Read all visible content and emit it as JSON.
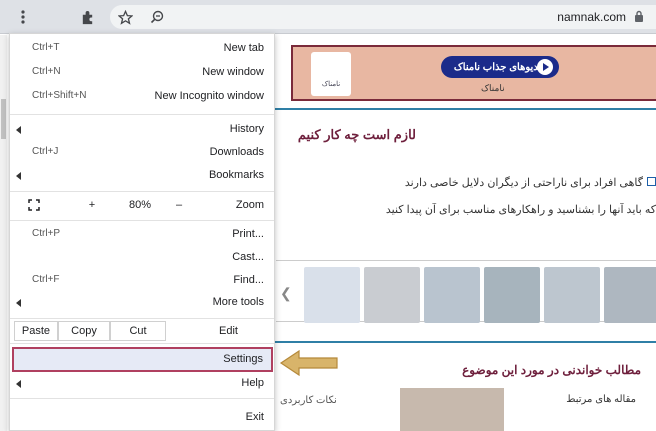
{
  "browser": {
    "url": "namnak.com",
    "icons": [
      "menu-dots-icon",
      "puzzle-extensions-icon",
      "bookmark-star-icon",
      "zoom-icon",
      "lock-icon"
    ]
  },
  "menu": {
    "new_tab": {
      "label": "New tab",
      "shortcut": "Ctrl+T"
    },
    "new_window": {
      "label": "New window",
      "shortcut": "Ctrl+N"
    },
    "new_incognito": {
      "label": "New Incognito window",
      "shortcut": "Ctrl+Shift+N"
    },
    "history": {
      "label": "History"
    },
    "downloads": {
      "label": "Downloads",
      "shortcut": "Ctrl+J"
    },
    "bookmarks": {
      "label": "Bookmarks"
    },
    "zoom": {
      "label": "Zoom",
      "minus": "–",
      "value": "80%",
      "plus": "+"
    },
    "print": {
      "label": "Print...",
      "shortcut": "Ctrl+P"
    },
    "cast": {
      "label": "Cast..."
    },
    "find": {
      "label": "Find...",
      "shortcut": "Ctrl+F"
    },
    "more_tools": {
      "label": "More tools"
    },
    "edit": {
      "label": "Edit",
      "cut": "Cut",
      "copy": "Copy",
      "paste": "Paste"
    },
    "settings": {
      "label": "Settings"
    },
    "help": {
      "label": "Help"
    },
    "exit": {
      "label": "Exit"
    }
  },
  "page": {
    "ad": {
      "logo_text": "نامناک",
      "pill_text": "ویدیوهای جذاب نامناک",
      "sub_text": "نامناک"
    },
    "heading": "ل‍ازم است چه کار کن‍ی‍م",
    "para_line1": "گاهی افراد برای ناراحتی از دیگران دلایل خاصی دارند",
    "para_line2": "که باید آنها را بشناسید و راهکارهای مناسب برای آن پیدا کنید",
    "bottom_title": "مطالب خواندنی در مورد این موضوع",
    "bottom_sub": "مقاله های مرتبط",
    "bottom_left": "نکات کاربردی"
  },
  "colors": {
    "toolbar": "#dee1e6",
    "accent_maroon": "#6e1f3c",
    "settings_highlight": "#e6eaf6",
    "settings_border": "#b04060",
    "pointer_arrow": "#c9a04a"
  }
}
